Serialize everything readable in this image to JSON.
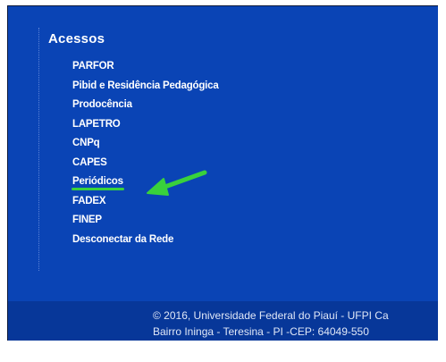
{
  "accesses": {
    "title": "Acessos",
    "items": [
      {
        "label": "PARFOR"
      },
      {
        "label": "Pibid e Residência Pedagógica"
      },
      {
        "label": "Prodocência"
      },
      {
        "label": "LAPETRO"
      },
      {
        "label": "CNPq"
      },
      {
        "label": "CAPES"
      },
      {
        "label": "Periódicos",
        "highlighted": true
      },
      {
        "label": "FADEX"
      },
      {
        "label": "FINEP"
      },
      {
        "label": "Desconectar da Rede"
      }
    ]
  },
  "annotation": {
    "icon": "arrow-left-icon",
    "color": "#39d13c"
  },
  "footer": {
    "line1": "© 2016, Universidade Federal do Piauí - UFPI Ca",
    "line2": "Bairro Ininga - Teresina - PI -CEP: 64049-550"
  },
  "colors": {
    "background": "#0a44b5",
    "footer": "#073799",
    "link": "#ffffff"
  }
}
